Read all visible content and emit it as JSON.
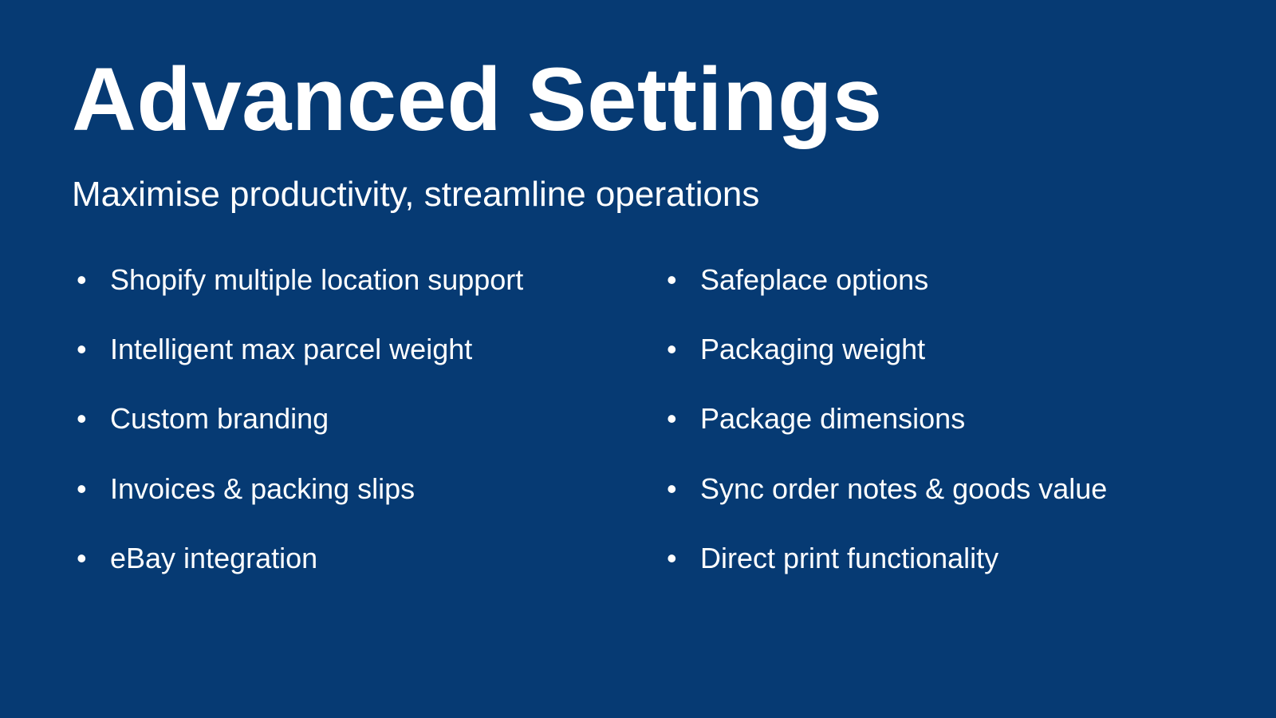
{
  "title": "Advanced Settings",
  "subtitle": "Maximise productivity, streamline operations",
  "columns": {
    "left": [
      "Shopify multiple location support",
      "Intelligent max parcel weight",
      "Custom branding",
      "Invoices & packing slips",
      "eBay integration"
    ],
    "right": [
      "Safeplace options",
      "Packaging weight",
      "Package dimensions",
      "Sync order notes & goods value",
      "Direct print functionality"
    ]
  }
}
